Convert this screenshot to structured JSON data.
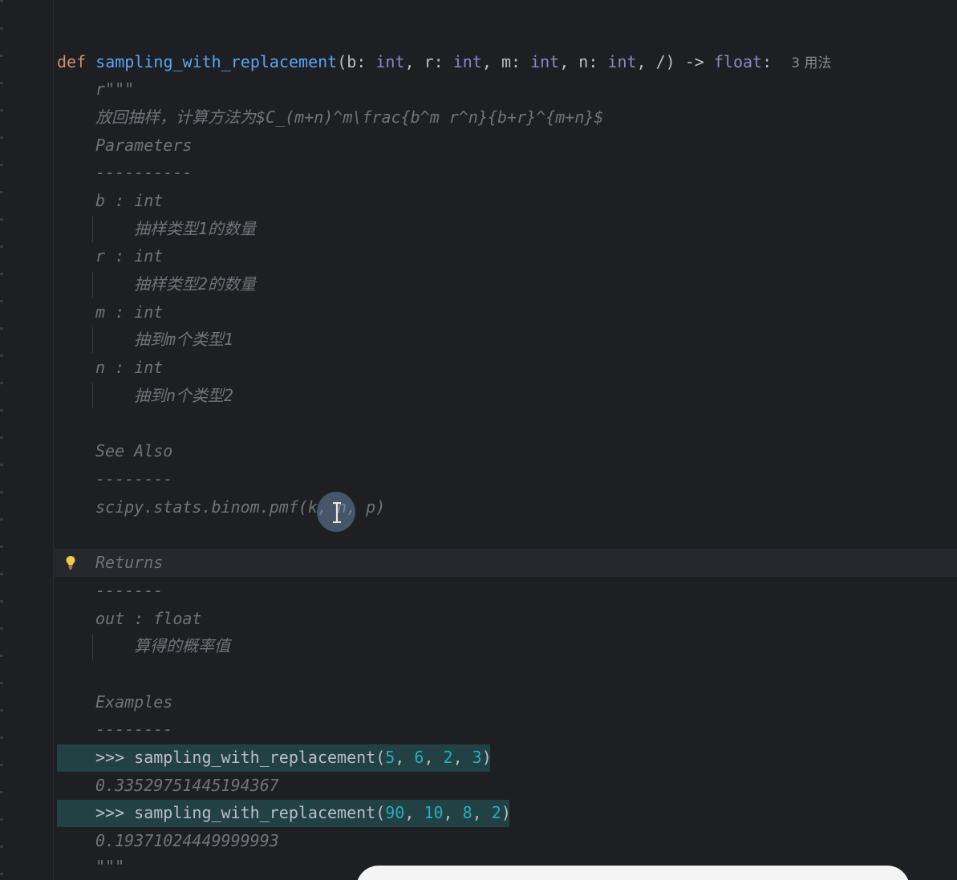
{
  "signature": {
    "kw_def": "def",
    "func_name": "sampling_with_replacement",
    "open_paren": "(",
    "p_b": "b: ",
    "t_b": "int",
    "sep1": ", ",
    "p_r": "r: ",
    "t_r": "int",
    "sep2": ", ",
    "p_m": "m: ",
    "t_m": "int",
    "sep3": ", ",
    "p_n": "n: ",
    "t_n": "int",
    "tail": ", /) -> ",
    "ret_type": "float",
    "colon": ":",
    "usages_hint": "3 用法"
  },
  "docstring": {
    "open": "r\"\"\"",
    "summary": "放回抽样，计算方法为$C_(m+n)^m\\frac{b^m r^n}{b+r}^{m+n}$",
    "params_header": "Parameters",
    "params_rule": "----------",
    "params": [
      {
        "decl": "b : int",
        "desc": "抽样类型1的数量"
      },
      {
        "decl": "r : int",
        "desc": "抽样类型2的数量"
      },
      {
        "decl": "m : int",
        "desc": "抽到m个类型1"
      },
      {
        "decl": "n : int",
        "desc": "抽到n个类型2"
      }
    ],
    "see_also_header": "See Also",
    "see_also_rule": "--------",
    "see_also_ref": "scipy.stats.binom.pmf(k, n, p)",
    "returns_header": "Returns",
    "returns_rule": "-------",
    "returns_decl": "out : float",
    "returns_desc": "算得的概率值",
    "examples_header": "Examples",
    "examples_rule": "--------",
    "examples": [
      {
        "prompt": ">>> ",
        "call": "sampling_with_replacement(",
        "args": [
          "5",
          "6",
          "2",
          "3"
        ],
        "result": "0.33529751445194367"
      },
      {
        "prompt": ">>> ",
        "call": "sampling_with_replacement(",
        "args": [
          "90",
          "10",
          "8",
          "2"
        ],
        "result": "0.19371024449999993"
      }
    ],
    "close": "\"\"\""
  },
  "colors": {
    "background": "#1e1f22",
    "keyword": "#cf8e6d",
    "function": "#56a8f5",
    "type": "#8888c6",
    "docstring": "#6f737a",
    "number": "#2aacb8",
    "selection": "#214145"
  },
  "icons": {
    "gutter_action": "lightbulb-icon",
    "mouse_cursor": "text-cursor-icon"
  }
}
